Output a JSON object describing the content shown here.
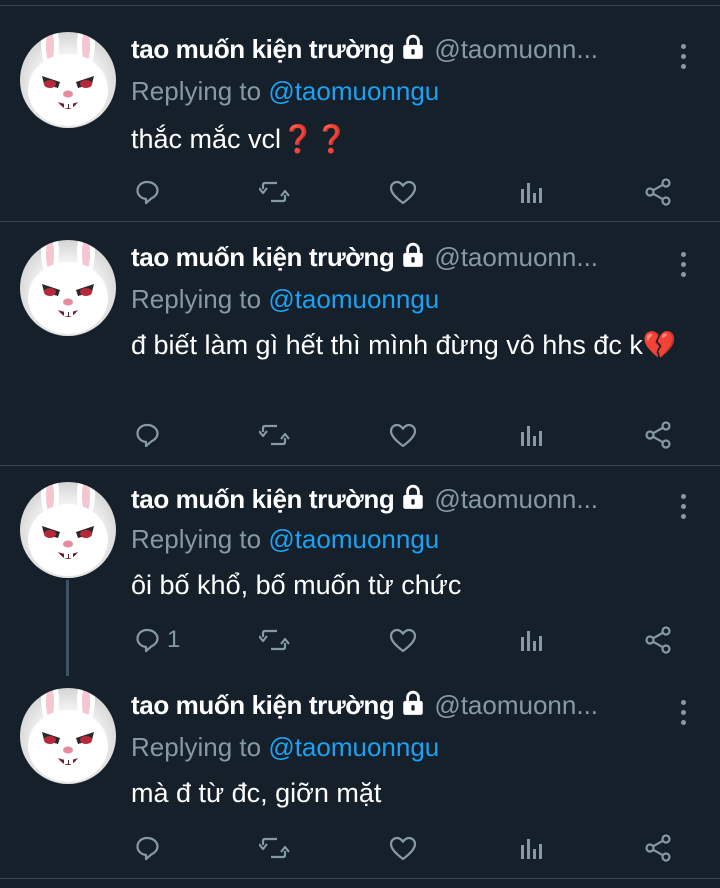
{
  "icons": {
    "lock": "lock-icon",
    "more": "more-vertical-icon",
    "reply": "comment-icon",
    "retweet": "retweet-icon",
    "like": "heart-icon",
    "analytics": "analytics-icon",
    "share": "share-icon"
  },
  "colors": {
    "background": "#15202b",
    "secondary_text": "#8899a6",
    "mention": "#1da1f2",
    "divider": "#38444d"
  },
  "tweets": [
    {
      "name": "tao muốn kiện trường",
      "handle": "@taomuonn...",
      "replying_label": "Replying to ",
      "replying_to": "@taomuonngu",
      "text": "thắc mắc vcl❓❓",
      "reply_count": ""
    },
    {
      "name": "tao muốn kiện trường",
      "handle": "@taomuonn...",
      "replying_label": "Replying to ",
      "replying_to": "@taomuonngu",
      "text": "đ biết làm gì hết thì mình đừng vô hhs đc k💔",
      "reply_count": ""
    },
    {
      "name": "tao muốn kiện trường",
      "handle": "@taomuonn...",
      "replying_label": "Replying to ",
      "replying_to": "@taomuonngu",
      "text": "ôi bố khổ, bố muốn từ chức",
      "reply_count": "1"
    },
    {
      "name": "tao muốn kiện trường",
      "handle": "@taomuonn...",
      "replying_label": "Replying to ",
      "replying_to": "@taomuonngu",
      "text": "mà đ từ đc, giỡn mặt",
      "reply_count": ""
    }
  ]
}
